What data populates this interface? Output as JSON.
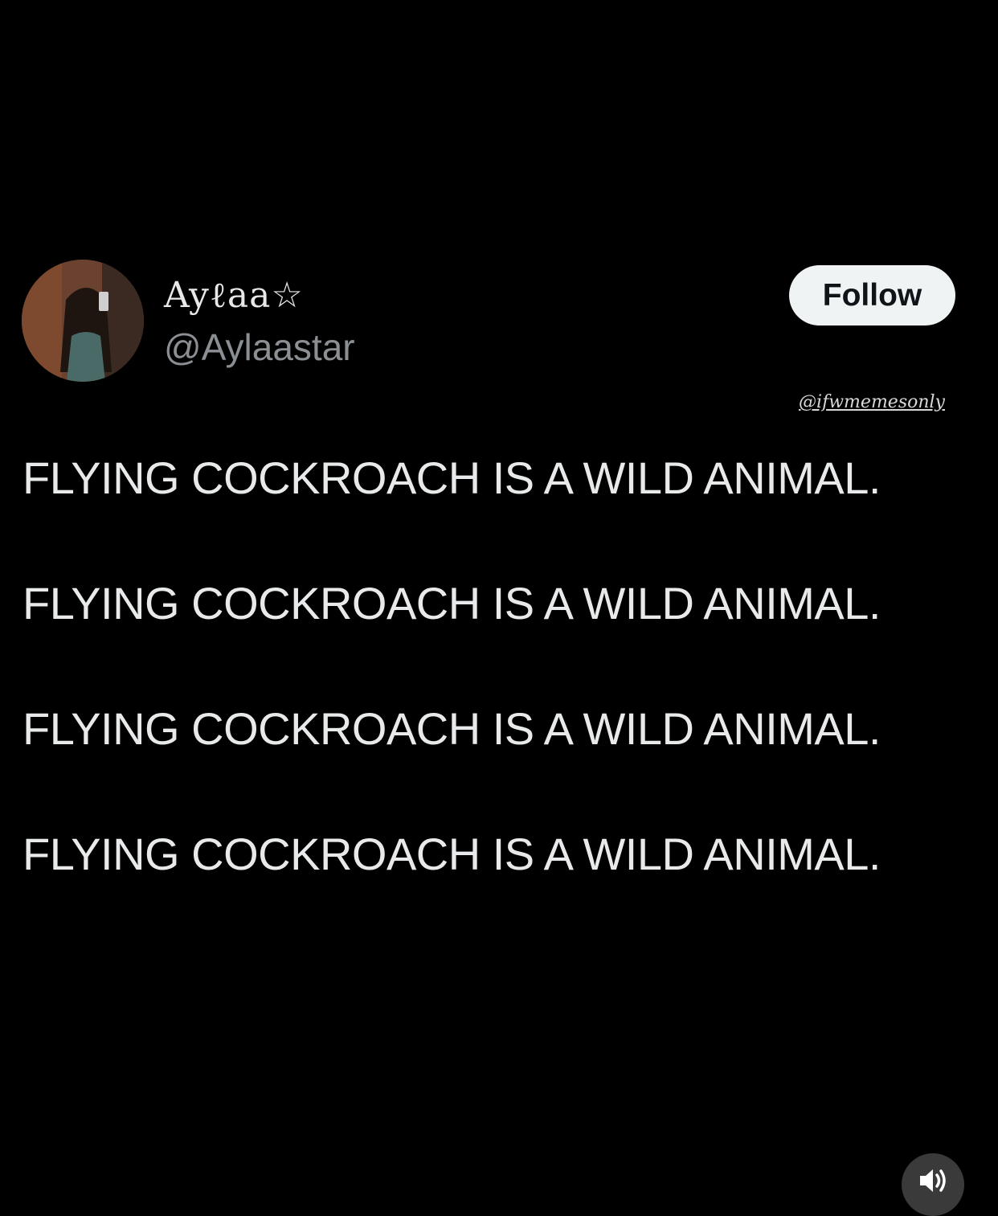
{
  "author": {
    "display_name": "Ayℓaa☆",
    "handle": "@Aylaastar",
    "avatar_icon": "profile-photo"
  },
  "follow_button": {
    "label": "Follow"
  },
  "watermark": {
    "text": "@ifwmemesonly"
  },
  "tweet": {
    "lines": [
      "FLYING COCKROACH IS A WILD ANIMAL.",
      "FLYING COCKROACH IS A WILD ANIMAL.",
      "FLYING COCKROACH IS A WILD ANIMAL.",
      "FLYING COCKROACH IS A WILD ANIMAL."
    ]
  },
  "controls": {
    "audio_icon": "speaker-volume-icon"
  },
  "colors": {
    "background": "#000000",
    "text": "#e7e9ea",
    "handle": "#8b8f94",
    "follow_bg": "#eff3f4",
    "follow_text": "#0f1419"
  }
}
